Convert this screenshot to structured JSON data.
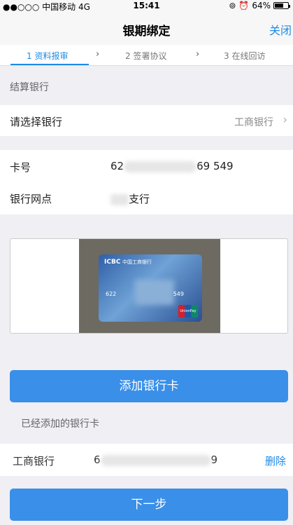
{
  "status_bar": {
    "carrier": "●●○○○ 中国移动  4G",
    "time": "15:41",
    "battery": "64%",
    "battery_level": 0.64,
    "icons": [
      "orientation-lock-icon",
      "alarm-icon",
      "battery-icon"
    ]
  },
  "nav": {
    "title": "银期绑定",
    "close_label": "关闭"
  },
  "steps": [
    {
      "label": "1 资料报审",
      "active": true
    },
    {
      "label": "2 签署协议",
      "active": false
    },
    {
      "label": "3 在线回访",
      "active": false
    }
  ],
  "settlement": {
    "section_title": "结算银行",
    "select_label": "请选择银行",
    "select_value": "工商银行"
  },
  "card_info": {
    "card_number_label": "卡号",
    "card_number_prefix": "62",
    "card_number_suffix": "69 549",
    "branch_label": "银行网点",
    "branch_value": "支行"
  },
  "card_image": {
    "brand": "ICBC",
    "bank_name": "中国工商银行",
    "number_left": "622",
    "number_right": "549",
    "network": "UnionPay"
  },
  "actions": {
    "add_card_label": "添加银行卡",
    "next_label": "下一步"
  },
  "added_cards": {
    "title": "已经添加的银行卡",
    "items": [
      {
        "bank": "工商银行",
        "number_prefix": "6",
        "number_suffix": "9",
        "delete_label": "删除"
      }
    ]
  },
  "colors": {
    "accent": "#1e8be6",
    "button": "#3a8fe8",
    "background": "#efeff4"
  }
}
